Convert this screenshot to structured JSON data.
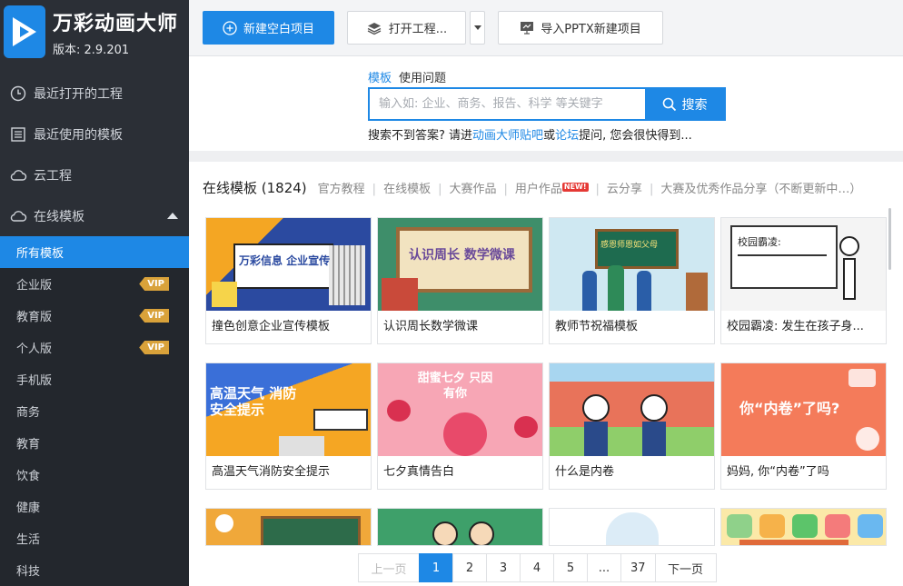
{
  "app": {
    "title": "万彩动画大师",
    "version": "版本: 2.9.201"
  },
  "nav": [
    {
      "label": "最近打开的工程",
      "icon": "clock-icon"
    },
    {
      "label": "最近使用的模板",
      "icon": "template-icon"
    },
    {
      "label": "云工程",
      "icon": "cloud-icon"
    },
    {
      "label": "在线模板",
      "icon": "cloud-outline-icon",
      "expanded": true
    }
  ],
  "subnav": [
    {
      "label": "所有模板",
      "active": true
    },
    {
      "label": "企业版",
      "badge": "VIP"
    },
    {
      "label": "教育版",
      "badge": "VIP"
    },
    {
      "label": "个人版",
      "badge": "VIP"
    },
    {
      "label": "手机版"
    },
    {
      "label": "商务"
    },
    {
      "label": "教育"
    },
    {
      "label": "饮食"
    },
    {
      "label": "健康"
    },
    {
      "label": "生活"
    },
    {
      "label": "科技"
    }
  ],
  "toolbar": {
    "new_blank": "新建空白项目",
    "open_project": "打开工程...",
    "import_pptx": "导入PPTX新建项目"
  },
  "search": {
    "tab_template": "模板",
    "tab_faq": "使用问题",
    "placeholder": "输入如: 企业、商务、报告、科学 等关键字",
    "button": "搜索",
    "help_prefix": "搜索不到答案? 请进",
    "help_link1": "动画大师贴吧",
    "help_or": "或",
    "help_link2": "论坛",
    "help_suffix": "提问, 您会很快得到..."
  },
  "tabs": {
    "main": "在线模板 (1824)",
    "items": [
      "官方教程",
      "在线模板",
      "大赛作品",
      "用户作品",
      "云分享",
      "大赛及优秀作品分享（不断更新中…）"
    ],
    "new_badge": "NEW!"
  },
  "templates": [
    {
      "title": "撞色创意企业宣传模板",
      "thumb_text": "万彩信息 企业宣传"
    },
    {
      "title": "认识周长数学微课",
      "thumb_text": "认识周长 数学微课"
    },
    {
      "title": "教师节祝福模板",
      "thumb_text": "感恩师恩如父母"
    },
    {
      "title": "校园霸凌: 发生在孩子身...",
      "thumb_text": "校园霸凌:"
    },
    {
      "title": "高温天气消防安全提示",
      "thumb_text": "高温天气 消防安全提示"
    },
    {
      "title": "七夕真情告白",
      "thumb_text": "甜蜜七夕 只因有你"
    },
    {
      "title": "什么是内卷",
      "thumb_text": ""
    },
    {
      "title": "妈妈, 你“内卷”了吗",
      "thumb_text": "你“内卷”了吗?"
    }
  ],
  "pager": {
    "prev": "上一页",
    "pages": [
      "1",
      "2",
      "3",
      "4",
      "5",
      "...",
      "37"
    ],
    "next": "下一页",
    "current": "1"
  },
  "colors": {
    "accent": "#1e88e5",
    "sidebar": "#2b2f36",
    "vip": "#d9a23a"
  }
}
